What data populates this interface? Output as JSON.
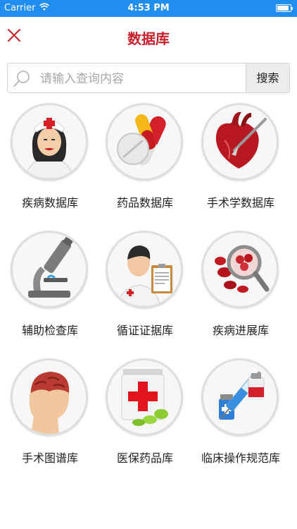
{
  "status_bar": {
    "carrier": "Carrier",
    "time": "4:53 PM",
    "battery_level": 0.9
  },
  "nav": {
    "title": "数据库"
  },
  "search": {
    "placeholder": "请输入查询内容",
    "value": "",
    "button_label": "搜索"
  },
  "databases": [
    {
      "label": "疾病数据库",
      "icon": "nurse-icon"
    },
    {
      "label": "药品数据库",
      "icon": "pills-icon"
    },
    {
      "label": "手术学数据库",
      "icon": "heart-scalpel-icon"
    },
    {
      "label": "辅助检查库",
      "icon": "microscope-icon"
    },
    {
      "label": "循证证据库",
      "icon": "doctor-clipboard-icon"
    },
    {
      "label": "疾病进展库",
      "icon": "blood-magnifier-icon"
    },
    {
      "label": "手术图谱库",
      "icon": "brain-head-icon"
    },
    {
      "label": "医保药品库",
      "icon": "medicine-bottle-icon"
    },
    {
      "label": "临床操作规范库",
      "icon": "syringe-vial-icon"
    }
  ],
  "colors": {
    "status_bar": "#1f8ef0",
    "title": "#c8202a",
    "close_icon": "#c8202a"
  }
}
